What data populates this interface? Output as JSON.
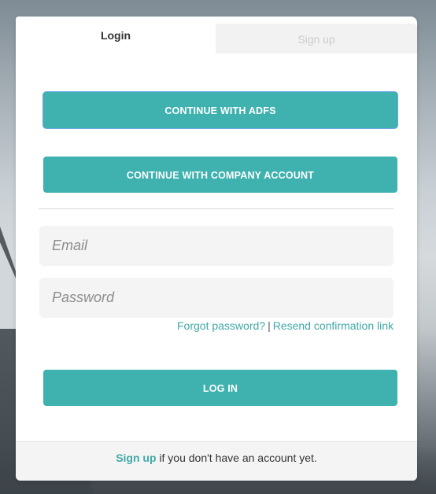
{
  "tabs": {
    "login_label": "Login",
    "signup_label": "Sign up"
  },
  "buttons": {
    "adfs_label": "CONTINUE WITH ADFS",
    "company_label": "CONTINUE WITH COMPANY ACCOUNT",
    "login_label": "LOG IN"
  },
  "form": {
    "email_placeholder": "Email",
    "email_value": "",
    "password_placeholder": "Password",
    "password_value": ""
  },
  "links": {
    "forgot_password": "Forgot password?",
    "separator": "|",
    "resend_confirmation": "Resend confirmation link"
  },
  "footer": {
    "signup_link": "Sign up",
    "text": " if you don't have an account yet."
  },
  "colors": {
    "accent": "#3fb1af",
    "link": "#3fa9a7",
    "field_bg": "#f4f4f4",
    "inactive_tab_bg": "#f2f2f2"
  },
  "icons": []
}
